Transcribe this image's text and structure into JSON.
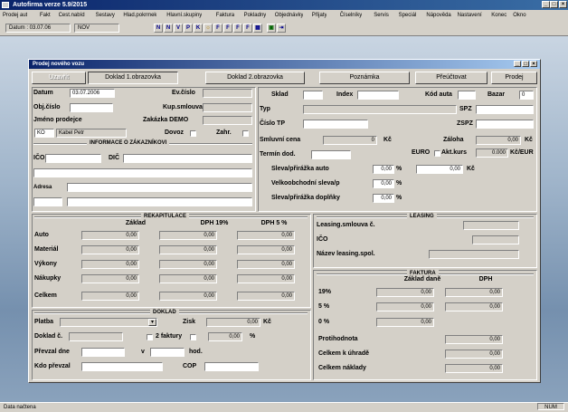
{
  "app": {
    "title": "Autofirma verze 5.9/2015",
    "menu": [
      "Prodej aut",
      "Fakt",
      "Cest.nabíd",
      "Sestavy",
      "Hlad.pokrmek",
      "Hlavní.skupiny",
      "Faktura",
      "Pokladny",
      "Objednávky",
      "Přijaty",
      "Číselníky",
      "Servis",
      "Speciál",
      "Nápověda",
      "Nastavení",
      "Konec",
      "Okno"
    ],
    "toolbar": {
      "date_label": "Datum : 03.07.06",
      "user": "NOV"
    },
    "status": "Data načtena",
    "status_right": "NUM"
  },
  "window": {
    "title": "Prodej nového vozu",
    "tabs": [
      "Uzavřít",
      "Doklad 1.obrazovka",
      "Doklad 2.obrazovka",
      "Poznámka",
      "Přeúčtovat",
      "Prodej"
    ]
  },
  "left_form": {
    "datum_label": "Datum",
    "datum_value": "03.07.2006",
    "evcislo_label": "Ev.číslo",
    "objcislo_label": "Obj.číslo",
    "kupsml_label": "Kup.smlouva",
    "jmeno_label": "Jméno prodejce",
    "zakazka_label": "Zakázka DEMO",
    "prodejce_code": "KO",
    "prodejce_name": "Kabel Petr",
    "dovoz_label": "Dovoz",
    "zahr_label": "Zahr."
  },
  "zakaznik": {
    "title": "INFORMACE O ZÁKAZNÍKOVI",
    "ico_label": "IČO",
    "dic_label": "DIČ",
    "adresa_label": "Adresa"
  },
  "vozidlo": {
    "sklad_label": "Sklad",
    "index_label": "Index",
    "kod_label": "Kód auta",
    "bazar_label": "Bazar",
    "bazar_value": "0",
    "typ_label": "Typ",
    "spz_label": "SPZ",
    "tp_label": "Číslo TP",
    "zspz_label": "ZSPZ",
    "cena_label": "Smluvní cena",
    "cena_value": "0",
    "cena_unit": "Kč",
    "zaloha_label": "Záloha",
    "zaloha_value": "0,00",
    "zaloha_unit": "Kč",
    "termin_label": "Termín dod.",
    "eur_label": "EURO",
    "akt_kurs_label": "Akt.kurs",
    "kurs_value": "0.000",
    "kurs_unit": "Kč/EUR",
    "slevy": [
      {
        "label": "Sleva/přirážka auto",
        "pct": "0,00",
        "pct_unit": "%",
        "kc": "0,00",
        "kc_unit": "Kč"
      },
      {
        "label": "Velkoobchodní sleva/p",
        "pct": "0,00",
        "pct_unit": "%"
      },
      {
        "label": "Sleva/přirážka doplňky",
        "pct": "0,00",
        "pct_unit": "%"
      }
    ]
  },
  "rekap": {
    "title": "REKAPITULACE",
    "headers": [
      "Základ",
      "DPH 19%",
      "DPH 5 %"
    ],
    "rows": [
      {
        "label": "Auto",
        "values": [
          "0,00",
          "0,00",
          "0,00"
        ]
      },
      {
        "label": "Materiál",
        "values": [
          "0,00",
          "0,00",
          "0,00"
        ]
      },
      {
        "label": "Výkony",
        "values": [
          "0,00",
          "0,00",
          "0,00"
        ]
      },
      {
        "label": "Nákupky",
        "values": [
          "0,00",
          "0,00",
          "0,00"
        ]
      },
      {
        "label": "Celkem",
        "values": [
          "0,00",
          "0,00",
          "0,00"
        ]
      }
    ]
  },
  "leasing": {
    "title": "LEASING",
    "smlouva_label": "Leasing.smlouva č.",
    "ico_label": "IČO",
    "nazev_label": "Název leasing.spol."
  },
  "doklad": {
    "title": "DOKLAD",
    "platba_label": "Platba",
    "zisk_label": "Zisk",
    "zisk_value": "0,00",
    "zisk_unit": "Kč",
    "doklad_label": "Doklad č.",
    "faktury_label": "2 faktury",
    "pct_value": "0,00",
    "pct_unit": "%",
    "prevzal_label": "Převzal dne",
    "v_label": "v",
    "hod_label": "hod.",
    "kdo_label": "Kdo převzal",
    "cop_label": "COP"
  },
  "faktura": {
    "title": "FAKTURA",
    "headers": [
      "Základ daně",
      "DPH"
    ],
    "rows": [
      {
        "label": "19%",
        "zaklad": "0,00",
        "dph": "0,00"
      },
      {
        "label": "5 %",
        "zaklad": "0,00",
        "dph": "0,00"
      },
      {
        "label": "0 %",
        "zaklad": "0,00",
        "dph": ""
      }
    ],
    "totals": [
      {
        "label": "Protihodnota",
        "value": "0,00"
      },
      {
        "label": "Celkem k úhradě",
        "value": "0,00"
      },
      {
        "label": "Celkem náklady",
        "value": "0,00"
      }
    ]
  },
  "colors": {
    "face": "#d4d0c8",
    "title_from": "#0a246a",
    "title_to": "#a6caf0",
    "field": "#ffffff"
  }
}
